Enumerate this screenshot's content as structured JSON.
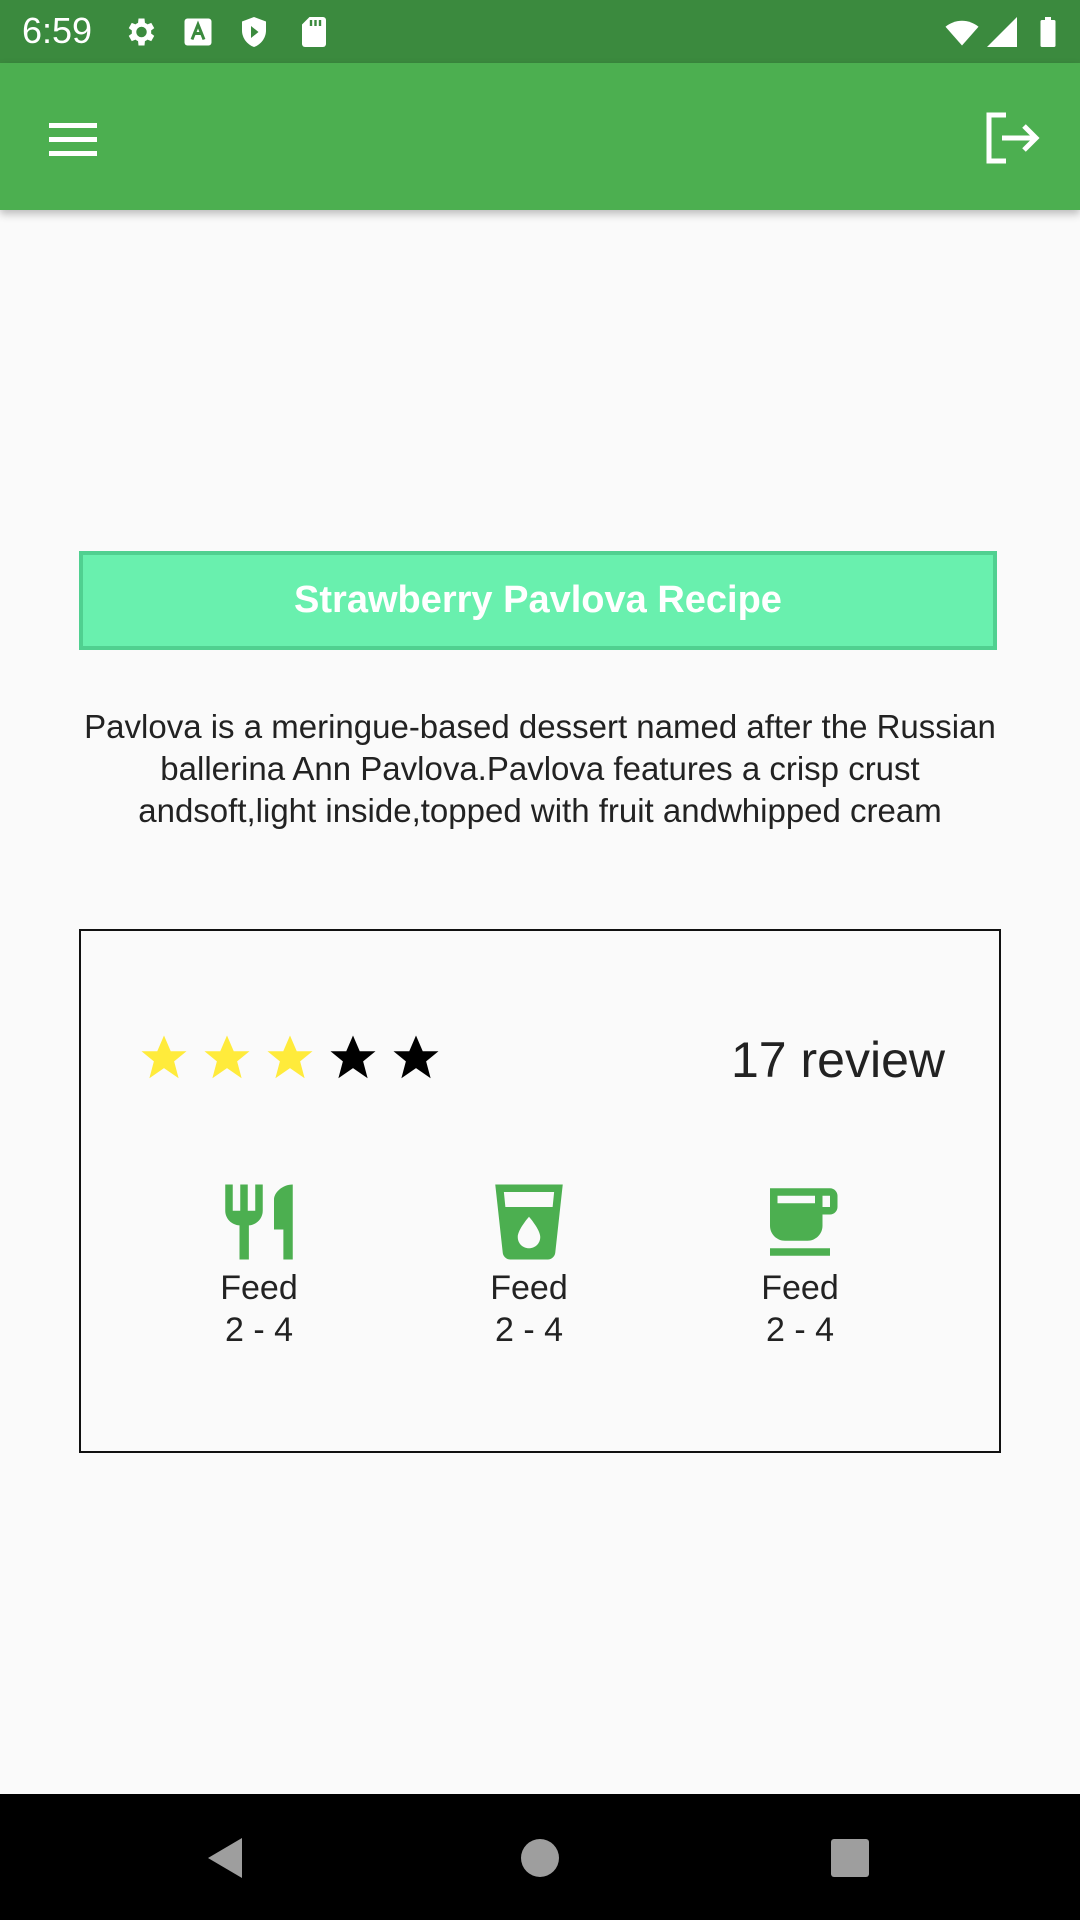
{
  "status_bar": {
    "time": "6:59",
    "icons": [
      "settings-icon",
      "a-icon",
      "shield-play-icon",
      "sd-card-icon",
      "wifi-icon",
      "signal-icon",
      "battery-icon"
    ]
  },
  "app_bar": {
    "menu_icon": "menu-icon",
    "logout_icon": "logout-icon",
    "color": "#4caf50"
  },
  "recipe": {
    "title": "Strawberry Pavlova Recipe",
    "description": "Pavlova is a meringue-based dessert named after the Russian ballerina Ann Pavlova.Pavlova features a crisp crust andsoft,light inside,topped with fruit andwhipped cream",
    "rating": 3,
    "max_rating": 5,
    "reviews": "17 review",
    "features": [
      {
        "icon": "restaurant-icon",
        "label": "Feed",
        "value": "2 - 4"
      },
      {
        "icon": "drink-icon",
        "label": "Feed",
        "value": "2 - 4"
      },
      {
        "icon": "coffee-icon",
        "label": "Feed",
        "value": "2 - 4"
      }
    ]
  },
  "colors": {
    "accent": "#4caf50",
    "title_bg": "#69f0ae",
    "star_filled": "#ffeb3b",
    "star_empty": "#000000"
  },
  "nav_bar": {
    "buttons": [
      "back-icon",
      "home-icon",
      "recents-icon"
    ]
  }
}
